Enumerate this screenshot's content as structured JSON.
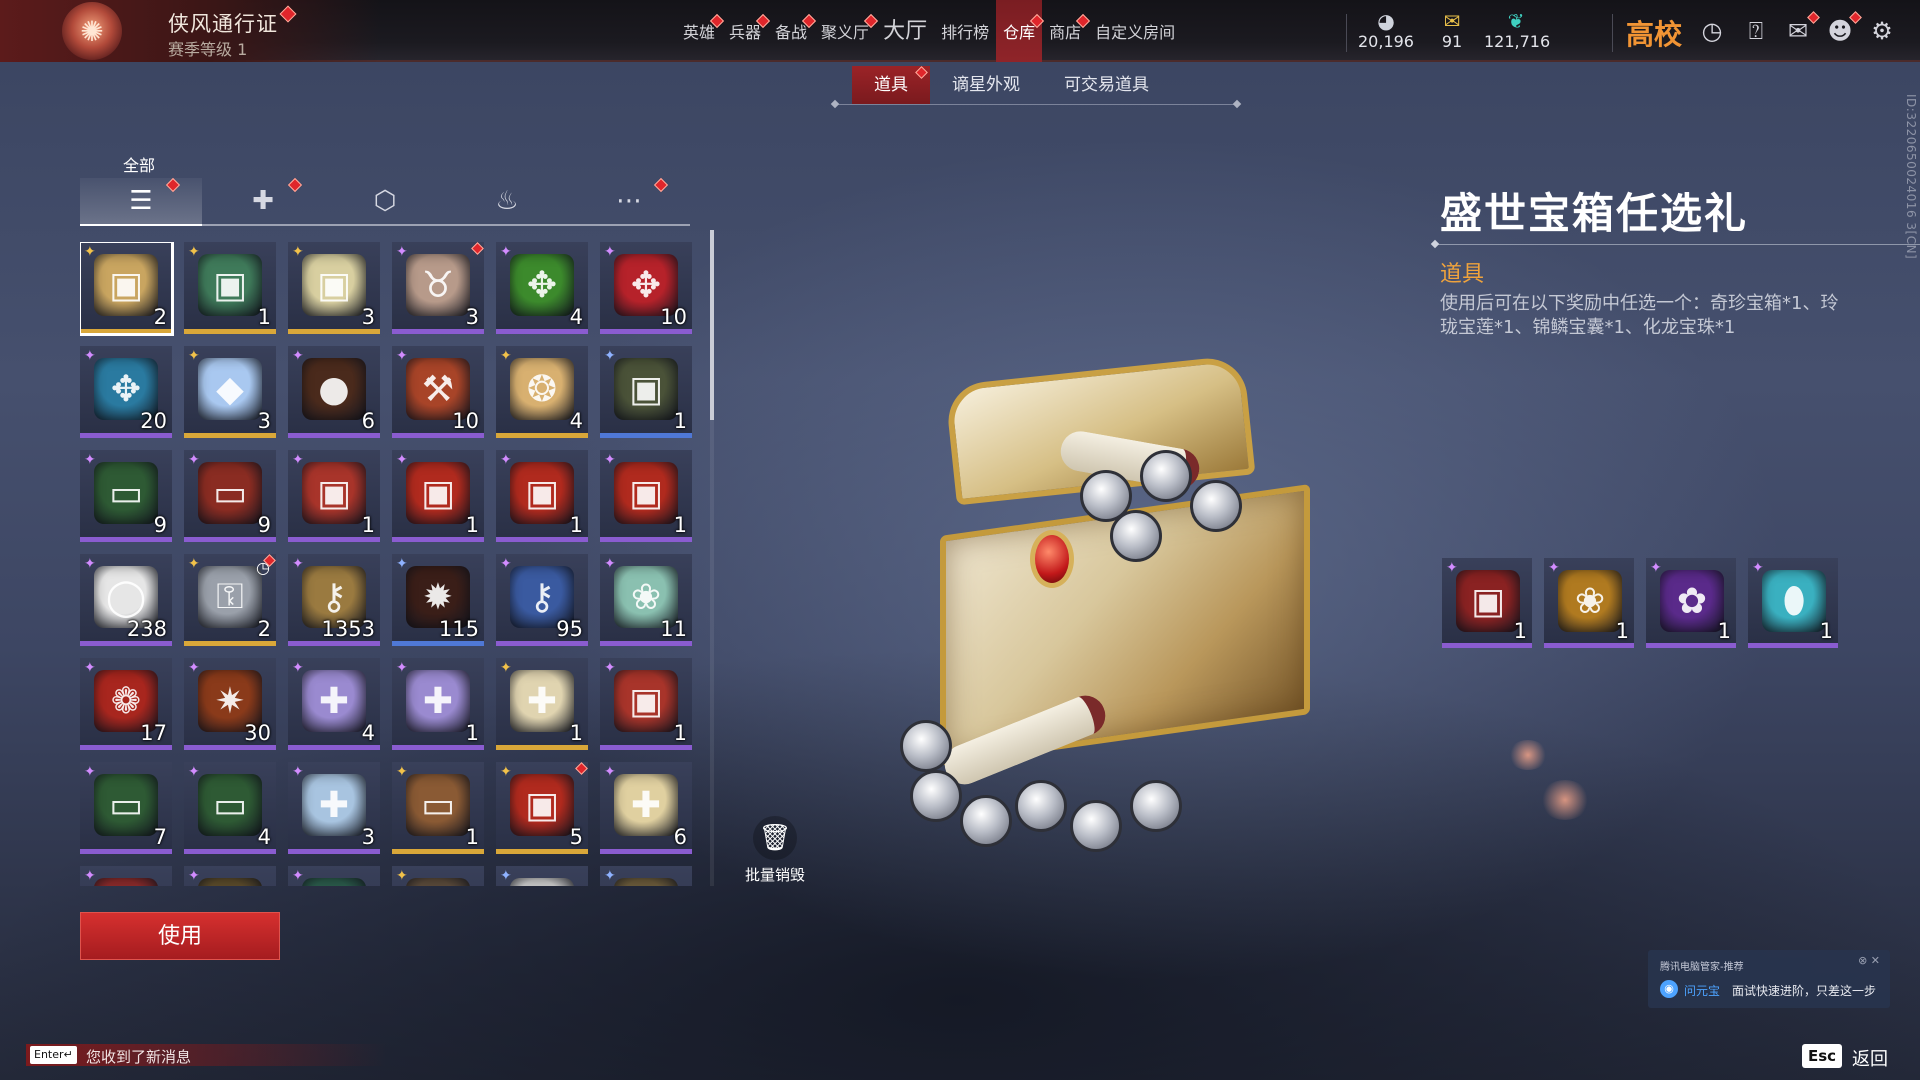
{
  "pass": {
    "title": "侠风通行证",
    "level": "赛季等级 1"
  },
  "nav": [
    {
      "label": "英雄",
      "dot": true,
      "big": false,
      "active": false
    },
    {
      "label": "兵器",
      "dot": true,
      "big": false,
      "active": false
    },
    {
      "label": "备战",
      "dot": true,
      "big": false,
      "active": false
    },
    {
      "label": "聚义厅",
      "dot": true,
      "big": false,
      "active": false
    },
    {
      "label": "大厅",
      "dot": false,
      "big": true,
      "active": false
    },
    {
      "label": "排行榜",
      "dot": false,
      "big": false,
      "active": false
    },
    {
      "label": "仓库",
      "dot": true,
      "big": false,
      "active": true
    },
    {
      "label": "商店",
      "dot": true,
      "big": false,
      "active": false
    },
    {
      "label": "自定义房间",
      "dot": false,
      "big": false,
      "active": false
    }
  ],
  "currency": [
    {
      "icon": "mask-coin-icon",
      "value": "20,196"
    },
    {
      "icon": "gold-ticket-icon",
      "value": "91"
    },
    {
      "icon": "jade-feather-icon",
      "value": "121,716"
    }
  ],
  "brand": "高校",
  "subtabs": [
    {
      "label": "道具",
      "active": true,
      "dot": true
    },
    {
      "label": "谪星外观",
      "active": false,
      "dot": false
    },
    {
      "label": "可交易道具",
      "active": false,
      "dot": false
    }
  ],
  "category_label": "全部",
  "categories": [
    {
      "icon": "layers-icon",
      "glyph": "☰",
      "active": true,
      "dot": true
    },
    {
      "icon": "gift-icon",
      "glyph": "✚",
      "active": false,
      "dot": true
    },
    {
      "icon": "badge-icon",
      "glyph": "⬡",
      "active": false,
      "dot": false
    },
    {
      "icon": "flame-icon",
      "glyph": "♨",
      "active": false,
      "dot": false
    },
    {
      "icon": "more-icon",
      "glyph": "⋯",
      "active": false,
      "dot": true
    }
  ],
  "items": [
    {
      "qty": "2",
      "rarity": "gold",
      "color": "#c9a560",
      "glyph": "▣",
      "selected": true
    },
    {
      "qty": "1",
      "rarity": "gold",
      "color": "#3f7a5a",
      "glyph": "▣"
    },
    {
      "qty": "3",
      "rarity": "gold",
      "color": "#d8cfa0",
      "glyph": "▣"
    },
    {
      "qty": "3",
      "rarity": "purple",
      "color": "#b79a8a",
      "glyph": "♉",
      "dot": true
    },
    {
      "qty": "4",
      "rarity": "purple",
      "color": "#3c8a2c",
      "glyph": "✥"
    },
    {
      "qty": "10",
      "rarity": "purple",
      "color": "#b6222a",
      "glyph": "✥"
    },
    {
      "qty": "20",
      "rarity": "purple",
      "color": "#2a7aa0",
      "glyph": "✥"
    },
    {
      "qty": "3",
      "rarity": "gold",
      "color": "#a9c8f0",
      "glyph": "◆"
    },
    {
      "qty": "6",
      "rarity": "purple",
      "color": "#4a2a1c",
      "glyph": "●"
    },
    {
      "qty": "10",
      "rarity": "purple",
      "color": "#a84428",
      "glyph": "⚒"
    },
    {
      "qty": "4",
      "rarity": "gold",
      "color": "#d8b070",
      "glyph": "❂"
    },
    {
      "qty": "1",
      "rarity": "blue",
      "color": "#4a5238",
      "glyph": "▣"
    },
    {
      "qty": "9",
      "rarity": "purple",
      "color": "#2e5a34",
      "glyph": "▭"
    },
    {
      "qty": "9",
      "rarity": "purple",
      "color": "#8a2c22",
      "glyph": "▭"
    },
    {
      "qty": "1",
      "rarity": "purple",
      "color": "#a8342a",
      "glyph": "▣"
    },
    {
      "qty": "1",
      "rarity": "purple",
      "color": "#b02a1e",
      "glyph": "▣"
    },
    {
      "qty": "1",
      "rarity": "purple",
      "color": "#b02a1e",
      "glyph": "▣"
    },
    {
      "qty": "1",
      "rarity": "purple",
      "color": "#b02a1e",
      "glyph": "▣"
    },
    {
      "qty": "238",
      "rarity": "purple",
      "color": "#e6e6e6",
      "glyph": "◯"
    },
    {
      "qty": "2",
      "rarity": "gold",
      "color": "#9aa0aa",
      "glyph": "⚿",
      "clock": true,
      "dot": true
    },
    {
      "qty": "1353",
      "rarity": "purple",
      "color": "#9a7a40",
      "glyph": "⚷"
    },
    {
      "qty": "115",
      "rarity": "blue",
      "color": "#3a1e18",
      "glyph": "✹"
    },
    {
      "qty": "95",
      "rarity": "purple",
      "color": "#3a5aa0",
      "glyph": "⚷"
    },
    {
      "qty": "11",
      "rarity": "purple",
      "color": "#8ac0b0",
      "glyph": "❀"
    },
    {
      "qty": "17",
      "rarity": "purple",
      "color": "#a8261e",
      "glyph": "❁"
    },
    {
      "qty": "30",
      "rarity": "purple",
      "color": "#8a3a1a",
      "glyph": "✷"
    },
    {
      "qty": "4",
      "rarity": "purple",
      "color": "#9a8ad0",
      "glyph": "✚"
    },
    {
      "qty": "1",
      "rarity": "purple",
      "color": "#9a8ad0",
      "glyph": "✚"
    },
    {
      "qty": "1",
      "rarity": "gold",
      "color": "#e0d4b0",
      "glyph": "✚"
    },
    {
      "qty": "1",
      "rarity": "purple",
      "color": "#a8342a",
      "glyph": "▣"
    },
    {
      "qty": "7",
      "rarity": "purple",
      "color": "#2e5a34",
      "glyph": "▭"
    },
    {
      "qty": "4",
      "rarity": "purple",
      "color": "#2e5a34",
      "glyph": "▭"
    },
    {
      "qty": "3",
      "rarity": "purple",
      "color": "#a8c4e0",
      "glyph": "✚"
    },
    {
      "qty": "1",
      "rarity": "gold",
      "color": "#8a5a34",
      "glyph": "▭"
    },
    {
      "qty": "5",
      "rarity": "gold",
      "color": "#b02a1e",
      "glyph": "▣",
      "dot": true
    },
    {
      "qty": "6",
      "rarity": "purple",
      "color": "#e0d0a0",
      "glyph": "✚"
    },
    {
      "qty": "",
      "rarity": "purple",
      "color": "#8a2a2a",
      "glyph": ""
    },
    {
      "qty": "",
      "rarity": "purple",
      "color": "#5a4a2a",
      "glyph": ""
    },
    {
      "qty": "",
      "rarity": "purple",
      "color": "#2a5a4a",
      "glyph": ""
    },
    {
      "qty": "",
      "rarity": "gold",
      "color": "#5a4a3a",
      "glyph": ""
    },
    {
      "qty": "",
      "rarity": "blue",
      "color": "#c8c8c8",
      "glyph": ""
    },
    {
      "qty": "",
      "rarity": "blue",
      "color": "#6a5a3a",
      "glyph": ""
    }
  ],
  "use_button": "使用",
  "destroy_label": "批量销毁",
  "detail": {
    "name": "盛世宝箱任选礼",
    "type": "道具",
    "description": "使用后可在以下奖励中任选一个：奇珍宝箱*1、玲珑宝莲*1、锦鳞宝囊*1、化龙宝珠*1",
    "rewards": [
      {
        "qty": "1",
        "rarity": "purple",
        "color": "#8a2222",
        "glyph": "▣"
      },
      {
        "qty": "1",
        "rarity": "purple",
        "color": "#b07a20",
        "glyph": "❀"
      },
      {
        "qty": "1",
        "rarity": "purple",
        "color": "#5a2a8a",
        "glyph": "✿"
      },
      {
        "qty": "1",
        "rarity": "purple",
        "color": "#3ab0c0",
        "glyph": "⬮"
      }
    ]
  },
  "side_id": "ID:3220650024016 3[CN]",
  "message": {
    "key": "Enter↵",
    "text": "您收到了新消息"
  },
  "esc": {
    "key": "Esc",
    "label": "返回"
  },
  "toast": {
    "title": "腾讯电脑管家-推荐",
    "close": "⊗ ✕",
    "icon": "◉",
    "brand": "问元宝",
    "text": "面试快速进阶，只差这一步"
  }
}
